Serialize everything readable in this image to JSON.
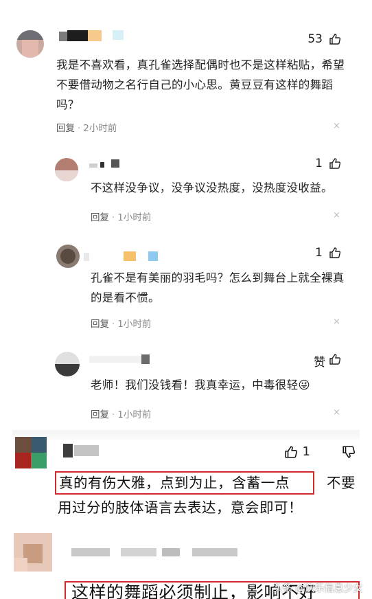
{
  "reply_label": "回复",
  "like_word": "赞",
  "close_glyph": "×",
  "comments": [
    {
      "id": "c1",
      "likes": "53",
      "time": "2小时前",
      "text": "我是不喜欢看，真孔雀选择配偶时也不是这样粘贴，希望不要借动物之名行自己的小心思。黄豆豆有这样的舞蹈吗？"
    },
    {
      "id": "c2",
      "likes": "1",
      "time": "1小时前",
      "text": "不这样没争议，没争议没热度，没热度没收益。"
    },
    {
      "id": "c3",
      "likes": "1",
      "time": "1小时前",
      "text": "孔雀不是有美丽的羽毛吗？怎么到舞台上就全裸真的是看不惯。"
    },
    {
      "id": "c4",
      "likes": "",
      "time": "1小时前",
      "text": "老师！我们没钱看！我真幸运，中毒很轻",
      "emoji": "😜"
    }
  ],
  "lower_comment_1": {
    "likes": "1",
    "highlight": "真的有伤大雅，点到为止，含蓄一点",
    "rest_line1": "不要",
    "line2": "用过分的肢体语言去表达，意会即可！"
  },
  "lower_comment_2": {
    "highlight": "这样的舞蹈必须制止，影响不好"
  },
  "watermark": "头条 @快乐信息少女"
}
